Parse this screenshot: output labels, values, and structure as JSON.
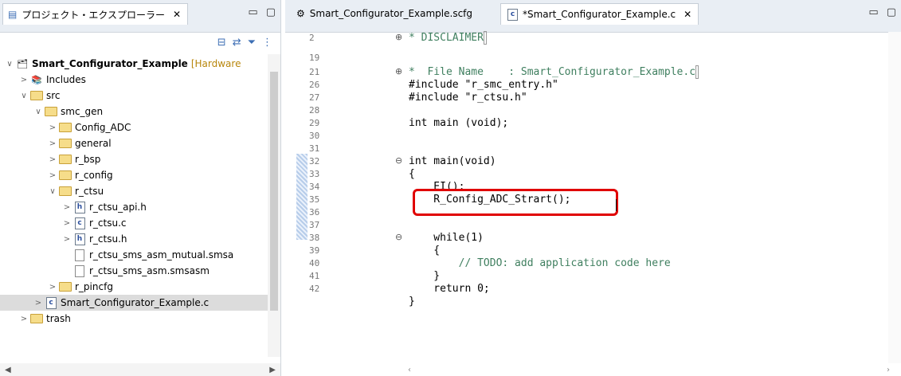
{
  "explorer": {
    "tab_title": "プロジェクト・エクスプローラー",
    "tree": [
      {
        "indent": 0,
        "arrow": "∨",
        "icon": "project",
        "label": "Smart_Configurator_Example",
        "suffix": "[Hardware"
      },
      {
        "indent": 1,
        "arrow": ">",
        "icon": "includes",
        "label": "Includes"
      },
      {
        "indent": 1,
        "arrow": "∨",
        "icon": "folder-src",
        "label": "src"
      },
      {
        "indent": 2,
        "arrow": "∨",
        "icon": "folder",
        "label": "smc_gen"
      },
      {
        "indent": 3,
        "arrow": ">",
        "icon": "folder",
        "label": "Config_ADC"
      },
      {
        "indent": 3,
        "arrow": ">",
        "icon": "folder",
        "label": "general"
      },
      {
        "indent": 3,
        "arrow": ">",
        "icon": "folder",
        "label": "r_bsp"
      },
      {
        "indent": 3,
        "arrow": ">",
        "icon": "folder",
        "label": "r_config"
      },
      {
        "indent": 3,
        "arrow": "∨",
        "icon": "folder",
        "label": "r_ctsu"
      },
      {
        "indent": 4,
        "arrow": ">",
        "icon": "h-file",
        "label": "r_ctsu_api.h"
      },
      {
        "indent": 4,
        "arrow": ">",
        "icon": "c-file",
        "label": "r_ctsu.c"
      },
      {
        "indent": 4,
        "arrow": ">",
        "icon": "h-file",
        "label": "r_ctsu.h"
      },
      {
        "indent": 4,
        "arrow": "",
        "icon": "text-file",
        "label": "r_ctsu_sms_asm_mutual.smsa"
      },
      {
        "indent": 4,
        "arrow": "",
        "icon": "text-file",
        "label": "r_ctsu_sms_asm.smsasm"
      },
      {
        "indent": 3,
        "arrow": ">",
        "icon": "folder",
        "label": "r_pincfg"
      },
      {
        "indent": 2,
        "arrow": ">",
        "icon": "c-file",
        "label": "Smart_Configurator_Example.c",
        "selected": true
      },
      {
        "indent": 1,
        "arrow": ">",
        "icon": "folder",
        "label": "trash"
      }
    ]
  },
  "editor": {
    "tabs": [
      {
        "label": "Smart_Configurator_Example.scfg",
        "icon": "gear-icon"
      },
      {
        "label": "*Smart_Configurator_Example.c",
        "icon": "c-file-icon",
        "active": true
      }
    ],
    "line_numbers": [
      "2",
      "19",
      "21",
      "26",
      "27",
      "28",
      "29",
      "30",
      "31",
      "32",
      "33",
      "34",
      "35",
      "36",
      "37",
      "38",
      "39",
      "40",
      "41",
      "42"
    ],
    "code_lines": [
      "* DISCLAIMER",
      "*  File Name    : Smart_Configurator_Example.c",
      "#include \"r_smc_entry.h\"",
      "#include \"r_ctsu.h\"",
      "int main (void);",
      "int main(void)",
      "{",
      "    EI();",
      "    R_Config_ADC_Strart();",
      "    while(1)",
      "    {",
      "        // TODO: add application code here",
      "    }",
      "    return 0;",
      "}"
    ]
  },
  "colors": {
    "keyword": "#7f0055",
    "string": "#2a00ff",
    "comment": "#3f7f5f",
    "highlight_box": "#e00000"
  }
}
